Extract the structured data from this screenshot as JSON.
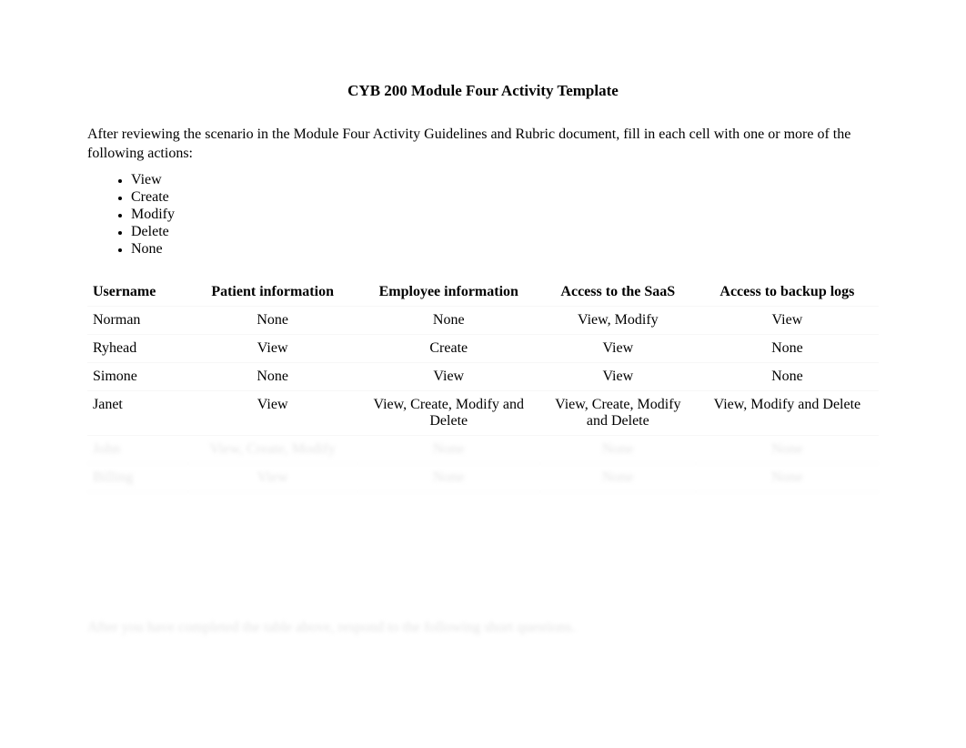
{
  "title": "CYB 200 Module Four Activity Template",
  "intro": "After reviewing the scenario in the Module Four Activity Guidelines and Rubric document, fill in each cell with one or more of the following actions:",
  "action_list": [
    "View",
    "Create",
    "Modify",
    "Delete",
    "None"
  ],
  "columns": {
    "username": "Username",
    "patient": "Patient information",
    "employee": "Employee information",
    "saas": "Access to the SaaS",
    "backup": "Access to backup logs"
  },
  "rows": [
    {
      "username": "Norman",
      "patient": "None",
      "employee": "None",
      "saas": "View, Modify",
      "backup": "View"
    },
    {
      "username": "Ryhead",
      "patient": "View",
      "employee": "Create",
      "saas": "View",
      "backup": "None"
    },
    {
      "username": "Simone",
      "patient": "None",
      "employee": "View",
      "saas": "View",
      "backup": "None"
    },
    {
      "username": "Janet",
      "patient": "View",
      "employee": "View, Create, Modify and Delete",
      "saas": "View, Create, Modify and Delete",
      "backup": "View, Modify and Delete"
    },
    {
      "username": "John",
      "patient": "View, Create, Modify",
      "employee": "None",
      "saas": "None",
      "backup": "None"
    },
    {
      "username": "Billing",
      "patient": "View",
      "employee": "None",
      "saas": "None",
      "backup": "None"
    }
  ],
  "after_note": "After you have completed the table above, respond to the following short questions."
}
